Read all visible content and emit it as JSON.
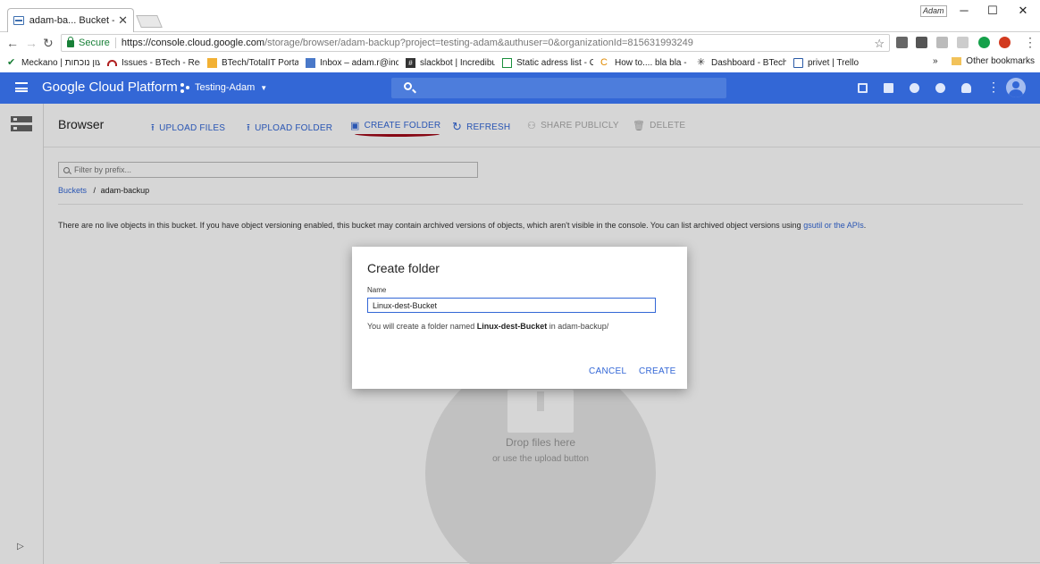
{
  "browser": {
    "tab_title": "adam-ba... Bucket - Testi",
    "window_user": "Adam",
    "secure_label": "Secure",
    "url_host": "https://console.cloud.google.com",
    "url_path": "/storage/browser/adam-backup?project=testing-adam&authuser=0&organizationId=815631993249",
    "bookmarks": [
      "Meckano | עון נוכחות",
      "Issues - BTech - Redn",
      "BTech/TotalIT Portal -",
      "Inbox – adam.r@incr",
      "slackbot | Incredibuil",
      "Static adress list - Go",
      "How to.... bla bla - Int",
      "Dashboard - BTech Sc",
      "privet | Trello"
    ],
    "bookmarks_overflow": "»",
    "other_bookmarks": "Other bookmarks"
  },
  "header": {
    "product": "Google Cloud Platform",
    "project": "Testing-Adam"
  },
  "page": {
    "title": "Browser",
    "actions": {
      "upload_files": "UPLOAD FILES",
      "upload_folder": "UPLOAD FOLDER",
      "create_folder": "CREATE FOLDER",
      "refresh": "REFRESH",
      "share_publicly": "SHARE PUBLICLY",
      "delete": "DELETE"
    },
    "filter_placeholder": "Filter by prefix...",
    "breadcrumb": {
      "root": "Buckets",
      "separator": "/",
      "current": "adam-backup"
    },
    "empty_message": "There are no live objects in this bucket. If you have object versioning enabled, this bucket may contain archived versions of objects, which aren't visible in the console. You can list archived object versions using ",
    "empty_link": "gsutil or the APIs",
    "empty_end": ".",
    "drop_title": "Drop files here",
    "drop_sub": "or use the upload button"
  },
  "dialog": {
    "title": "Create folder",
    "name_label": "Name",
    "name_value": "Linux-dest-Bucket",
    "help_prefix": "You will create a folder named ",
    "help_name": "Linux-dest-Bucket",
    "help_suffix": " in adam-backup/",
    "cancel": "CANCEL",
    "create": "CREATE"
  },
  "colors": {
    "gcp_blue": "#3367d6",
    "annotation_red": "#a10a1a"
  }
}
